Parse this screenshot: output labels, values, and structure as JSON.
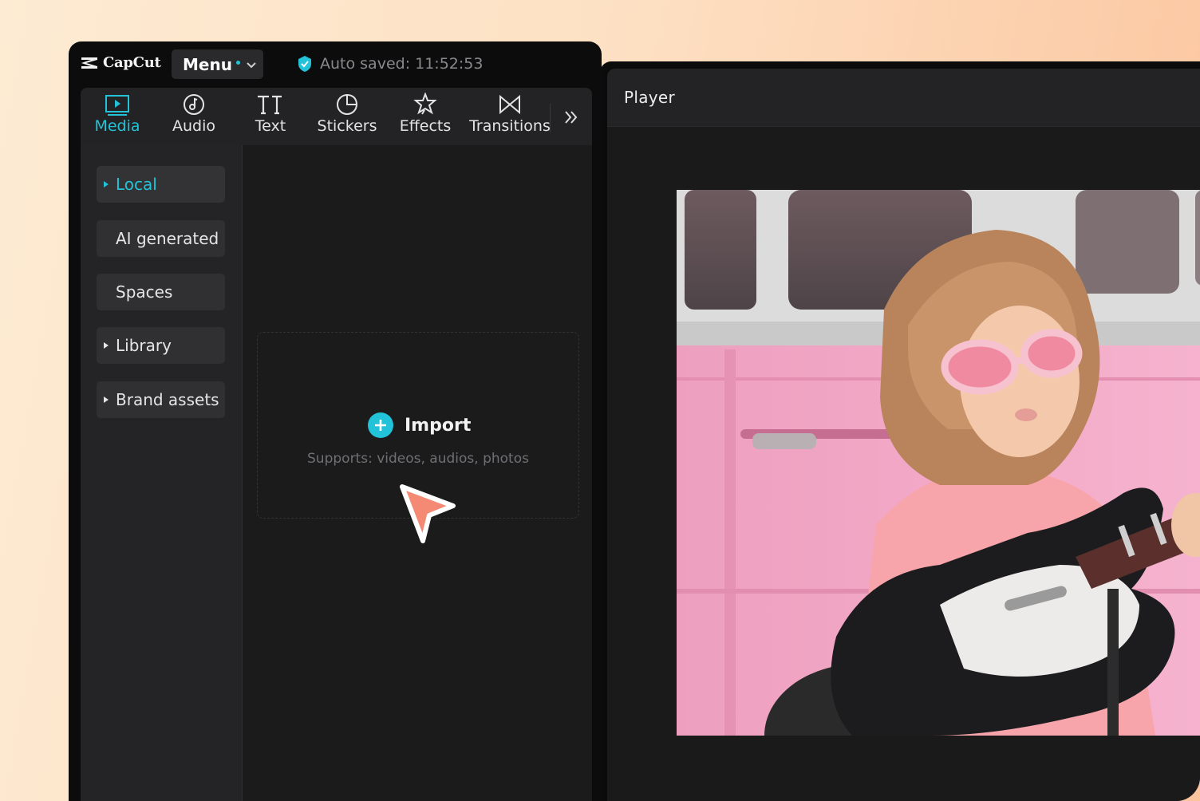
{
  "app": {
    "name": "CapCut"
  },
  "header": {
    "menu_label": "Menu",
    "autosave_text": "Auto saved: 11:52:53"
  },
  "tabs": [
    {
      "label": "Media",
      "icon": "media-icon",
      "active": true
    },
    {
      "label": "Audio",
      "icon": "audio-icon"
    },
    {
      "label": "Text",
      "icon": "text-icon"
    },
    {
      "label": "Stickers",
      "icon": "stickers-icon"
    },
    {
      "label": "Effects",
      "icon": "effects-icon"
    },
    {
      "label": "Transitions",
      "icon": "transitions-icon"
    }
  ],
  "more_tabs_icon": "double-chevron-right-icon",
  "sidebar": {
    "items": [
      {
        "label": "Local",
        "active": true,
        "arrow": true
      },
      {
        "label": "AI generated",
        "arrow": false
      },
      {
        "label": "Spaces",
        "arrow": false
      },
      {
        "label": "Library",
        "arrow": true
      },
      {
        "label": "Brand assets",
        "arrow": true
      }
    ]
  },
  "import": {
    "label": "Import",
    "hint": "Supports: videos, audios, photos"
  },
  "player": {
    "title": "Player"
  },
  "colors": {
    "accent": "#22c3d8",
    "cursor": "#f48a73",
    "panel": "#1b1b1c",
    "background_gradient_end": "#fcc49d"
  }
}
